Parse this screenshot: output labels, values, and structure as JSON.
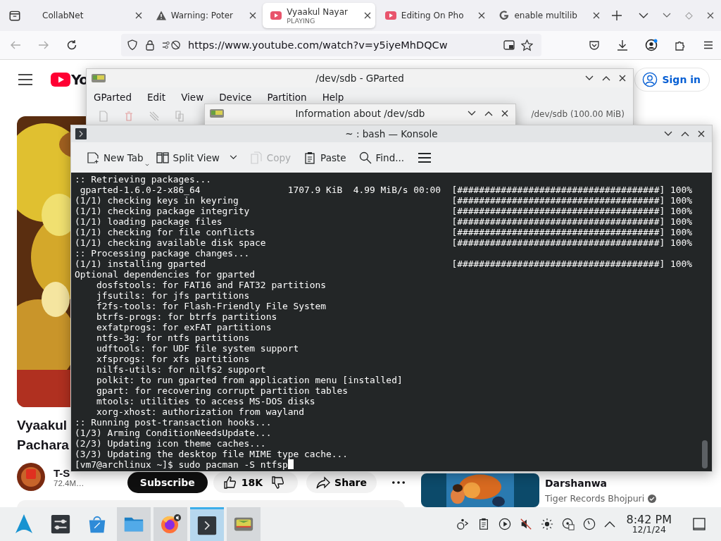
{
  "browser": {
    "tabs": [
      {
        "title": "CollabNet",
        "selected": false
      },
      {
        "title": "Warning: Poter",
        "selected": false
      },
      {
        "title": "Vyaakul Nayar",
        "subtitle": "PLAYING",
        "selected": true
      },
      {
        "title": "Editing On Pho",
        "selected": false
      },
      {
        "title": "enable multilib",
        "selected": false
      }
    ],
    "url": "https://www.youtube.com/watch?v=y5iyeMhDQCw"
  },
  "youtube": {
    "logo_text": "Yo",
    "sign_in": "Sign in",
    "video_title": [
      "Vyaakul",
      "Pachara"
    ],
    "channel": "T-S",
    "subscribers": "72.4M…",
    "subscribe": "Subscribe",
    "likes": "18K",
    "share": "Share",
    "recommendation": {
      "title": "Darshanwa",
      "channel": "Tiger Records Bhojpuri"
    }
  },
  "gparted": {
    "title": "/dev/sdb - GParted",
    "menu": [
      "GParted",
      "Edit",
      "View",
      "Device",
      "Partition",
      "Help"
    ],
    "device": "/dev/sdb (100.00 MiB)"
  },
  "info_dialog": {
    "title": "Information about /dev/sdb"
  },
  "konsole": {
    "title": "~ : bash — Konsole",
    "toolbar": [
      {
        "label": "New Tab",
        "disabled": false
      },
      {
        "label": "Split View",
        "disabled": false
      },
      {
        "label": "Copy",
        "disabled": true
      },
      {
        "label": "Paste",
        "disabled": false
      },
      {
        "label": "Find...",
        "disabled": false
      }
    ],
    "lines": [
      {
        "text": ":: Retrieving packages..."
      },
      {
        "text": " gparted-1.6.0-2-x86_64                1707.9 KiB  4.99 MiB/s 00:00",
        "progress": "[#####################################] 100%"
      },
      {
        "text": "(1/1) checking keys in keyring",
        "progress": "[#####################################] 100%"
      },
      {
        "text": "(1/1) checking package integrity",
        "progress": "[#####################################] 100%"
      },
      {
        "text": "(1/1) loading package files",
        "progress": "[#####################################] 100%"
      },
      {
        "text": "(1/1) checking for file conflicts",
        "progress": "[#####################################] 100%"
      },
      {
        "text": "(1/1) checking available disk space",
        "progress": "[#####################################] 100%"
      },
      {
        "text": ":: Processing package changes..."
      },
      {
        "text": "(1/1) installing gparted",
        "progress": "[#####################################] 100%"
      },
      {
        "text": "Optional dependencies for gparted"
      },
      {
        "text": "    dosfstools: for FAT16 and FAT32 partitions"
      },
      {
        "text": "    jfsutils: for jfs partitions"
      },
      {
        "text": "    f2fs-tools: for Flash-Friendly File System"
      },
      {
        "text": "    btrfs-progs: for btrfs partitions"
      },
      {
        "text": "    exfatprogs: for exFAT partitions"
      },
      {
        "text": "    ntfs-3g: for ntfs partitions"
      },
      {
        "text": "    udftools: for UDF file system support"
      },
      {
        "text": "    xfsprogs: for xfs partitions"
      },
      {
        "text": "    nilfs-utils: for nilfs2 support"
      },
      {
        "text": "    polkit: to run gparted from application menu [installed]"
      },
      {
        "text": "    gpart: for recovering corrupt partition tables"
      },
      {
        "text": "    mtools: utilities to access MS-DOS disks"
      },
      {
        "text": "    xorg-xhost: authorization from wayland"
      },
      {
        "text": ":: Running post-transaction hooks..."
      },
      {
        "text": "(1/3) Arming ConditionNeedsUpdate..."
      },
      {
        "text": "(2/3) Updating icon theme caches..."
      },
      {
        "text": "(3/3) Updating the desktop file MIME type cache..."
      },
      {
        "text": "[vm7@archlinux ~]$ sudo pacman -S ntfsp",
        "cursor": true
      }
    ]
  },
  "taskbar": {
    "tasks": [
      {
        "open": false,
        "selected": false
      },
      {
        "open": false,
        "selected": false
      },
      {
        "open": false,
        "selected": false
      },
      {
        "open": true,
        "selected": false
      },
      {
        "open": true,
        "selected": false
      },
      {
        "open": true,
        "selected": true
      },
      {
        "open": true,
        "selected": false
      }
    ],
    "time": "8:42 PM",
    "date": "12/1/24"
  }
}
